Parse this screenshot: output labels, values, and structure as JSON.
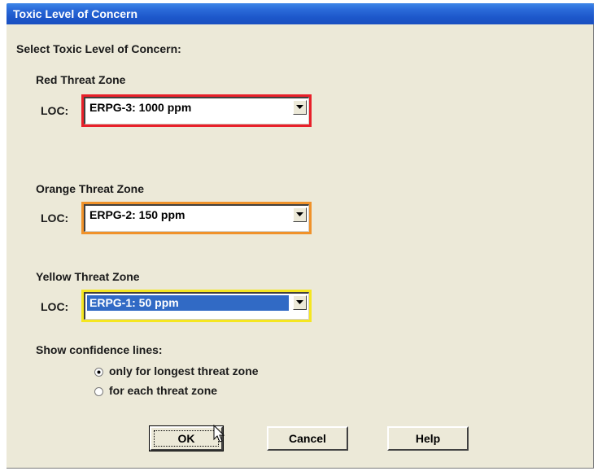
{
  "window": {
    "title": "Toxic Level of Concern"
  },
  "heading": "Select Toxic Level of Concern:",
  "zones": [
    {
      "title": "Red Threat Zone",
      "loc_label": "LOC:",
      "value": "ERPG-3: 1000 ppm",
      "border_color": "#e8202a",
      "selected": false
    },
    {
      "title": "Orange Threat Zone",
      "loc_label": "LOC:",
      "value": "ERPG-2: 150 ppm",
      "border_color": "#f0922a",
      "selected": false
    },
    {
      "title": "Yellow Threat Zone",
      "loc_label": "LOC:",
      "value": "ERPG-1: 50 ppm",
      "border_color": "#f5e620",
      "selected": true
    }
  ],
  "confidence": {
    "label": "Show confidence lines:",
    "options": [
      {
        "label": "only for longest threat zone",
        "checked": true
      },
      {
        "label": "for each threat zone",
        "checked": false
      }
    ]
  },
  "buttons": {
    "ok": "OK",
    "cancel": "Cancel",
    "help": "Help"
  },
  "colors": {
    "titlebar": "#1c56c9",
    "dialog_bg": "#ece9d8",
    "selection": "#316ac5"
  }
}
